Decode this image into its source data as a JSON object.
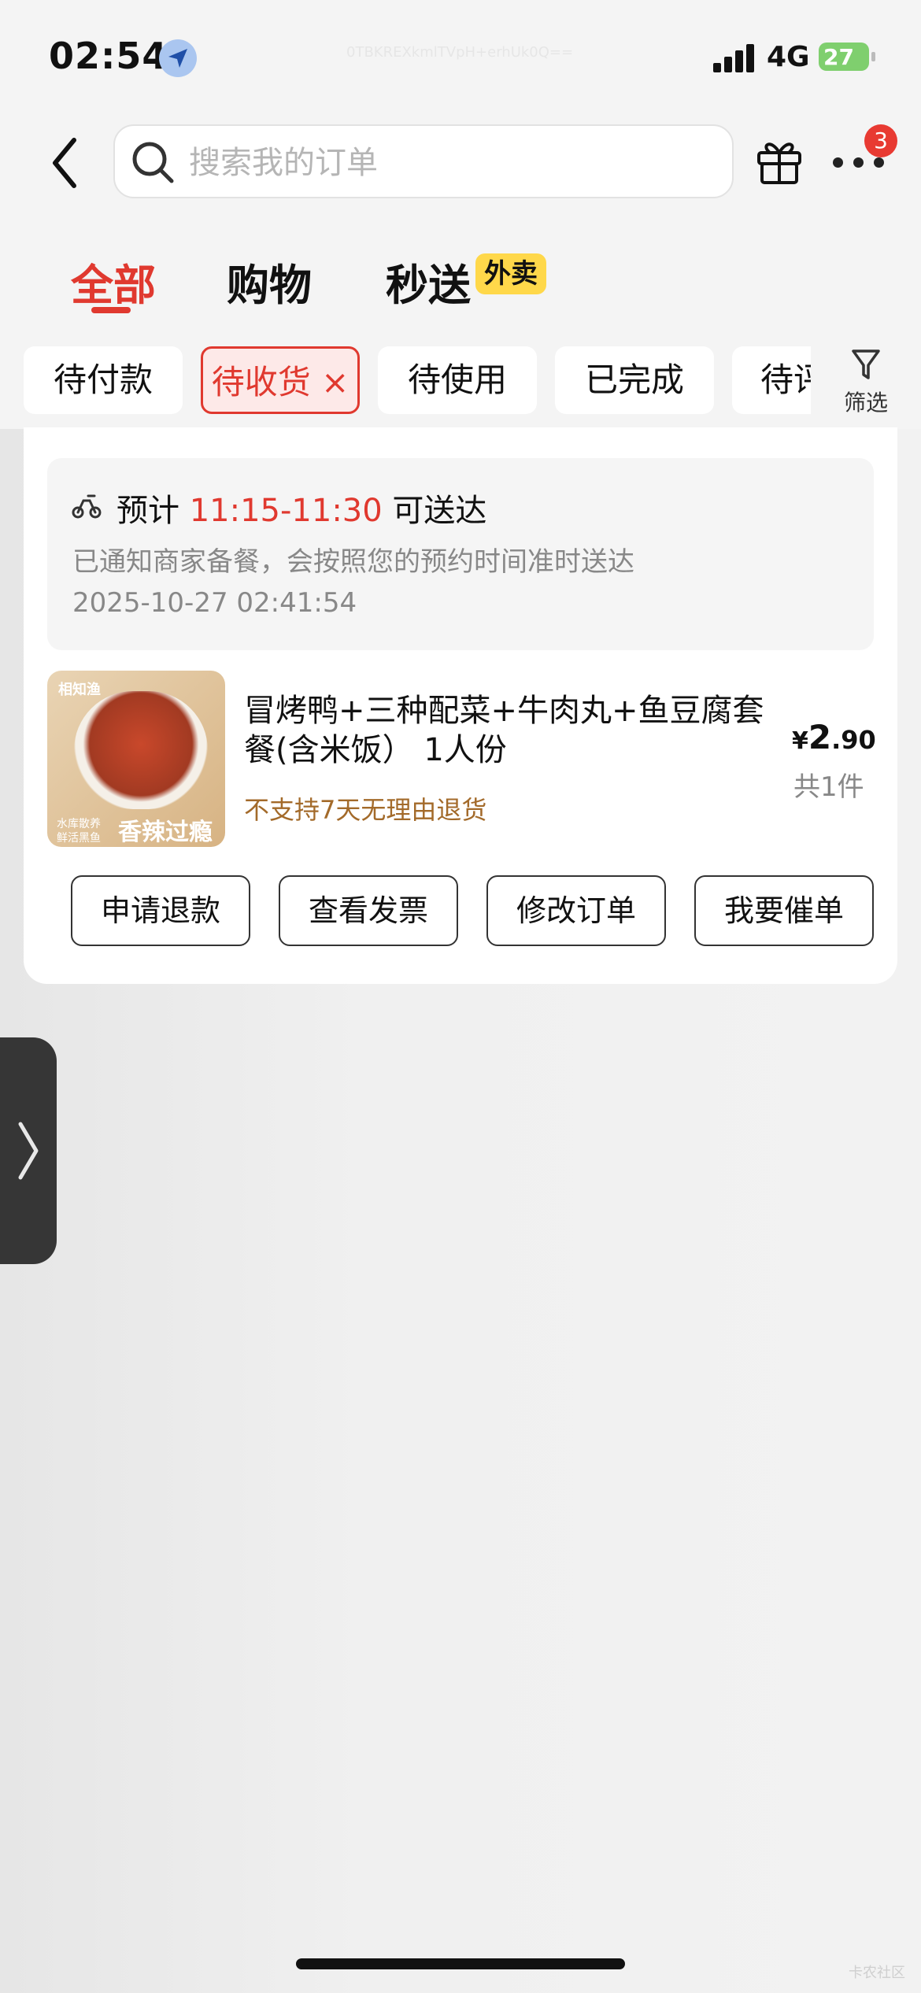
{
  "status_bar": {
    "time": "02:54",
    "device_id": "0TBKREXkmlTVpH+erhUk0Q==",
    "network": "4G",
    "battery": "27"
  },
  "header": {
    "search_placeholder": "搜索我的订单",
    "notification_count": "3"
  },
  "tabs": [
    {
      "label": "全部",
      "active": true
    },
    {
      "label": "购物",
      "active": false
    },
    {
      "label": "秒送",
      "active": false,
      "tag": "外卖"
    }
  ],
  "filters": {
    "chips": [
      "待付款",
      "待收货 ×",
      "待使用",
      "已完成",
      "待评"
    ],
    "selected": "待收货",
    "filter_label": "筛选"
  },
  "order": {
    "eta_prefix": "预计",
    "eta_time": "11:15-11:30",
    "eta_suffix": "可送达",
    "notice": "已通知商家备餐，会按照您的预约时间准时送达",
    "timestamp": "2025-10-27 02:41:54",
    "image_brand": "相知渔",
    "image_slogan": "香辣过瘾",
    "image_small": "水库散养 鲜活黑鱼",
    "product_name": "冒烤鸭+三种配菜+牛肉丸+鱼豆腐套餐(含米饭） 1人份",
    "price_currency": "¥",
    "price_int": "2",
    "price_dec": ".90",
    "quantity": "共1件",
    "policy": "不支持7天无理由退货",
    "actions": [
      "申请退款",
      "查看发票",
      "修改订单",
      "我要催单"
    ]
  },
  "colors": {
    "accent": "#e0392f",
    "tag_yellow": "#ffd84a",
    "policy_brown": "#a36a2a"
  },
  "watermark": "卡农社区"
}
